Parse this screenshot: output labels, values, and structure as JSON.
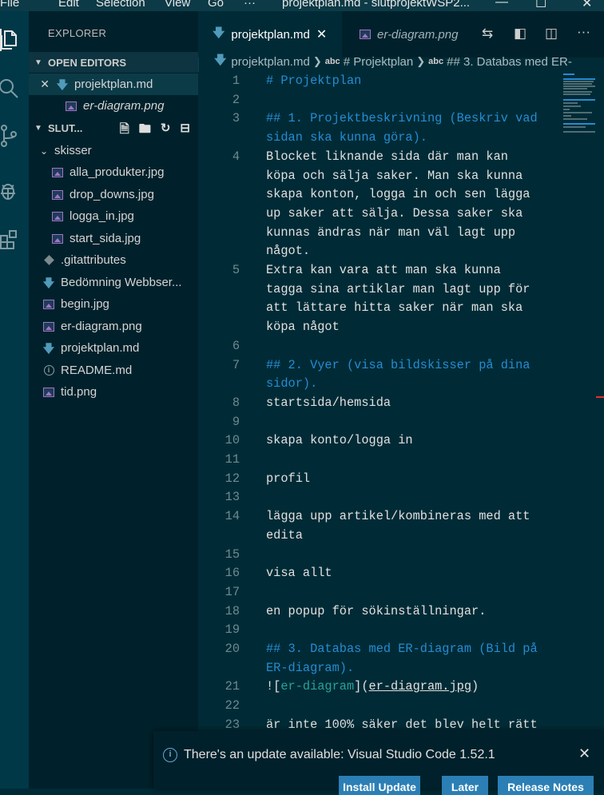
{
  "titlebar": {
    "menu": [
      "File",
      "Edit",
      "Selection",
      "View",
      "Go",
      "···"
    ],
    "title": "projektplan.md - slutprojektWSP2..."
  },
  "sidebar": {
    "title": "EXPLORER",
    "open_editors_label": "OPEN EDITORS",
    "open_editors": [
      {
        "name": "projektplan.md",
        "icon": "markdown-icon"
      },
      {
        "name": "er-diagram.png",
        "icon": "image-icon"
      }
    ],
    "folder_label": "SLUT...",
    "tree": [
      {
        "name": "skisser",
        "type": "folder"
      },
      {
        "name": "alla_produkter.jpg",
        "icon": "image-icon",
        "indent": 2
      },
      {
        "name": "drop_downs.jpg",
        "icon": "image-icon",
        "indent": 2
      },
      {
        "name": "logga_in.jpg",
        "icon": "image-icon",
        "indent": 2
      },
      {
        "name": "start_sida.jpg",
        "icon": "image-icon",
        "indent": 2
      },
      {
        "name": ".gitattributes",
        "icon": "git-icon",
        "indent": 1
      },
      {
        "name": "Bedömning Webbser...",
        "icon": "markdown-icon",
        "indent": 1
      },
      {
        "name": "begin.jpg",
        "icon": "image-icon",
        "indent": 1
      },
      {
        "name": "er-diagram.png",
        "icon": "image-icon",
        "indent": 1
      },
      {
        "name": "projektplan.md",
        "icon": "markdown-icon",
        "indent": 1
      },
      {
        "name": "README.md",
        "icon": "info-icon",
        "indent": 1
      },
      {
        "name": "tid.png",
        "icon": "image-icon",
        "indent": 1
      }
    ]
  },
  "tabs": [
    {
      "label": "projektplan.md",
      "active": true
    },
    {
      "label": "er-diagram.png",
      "active": false
    }
  ],
  "breadcrumb": {
    "file": "projektplan.md",
    "symbol1": "# Projektplan",
    "symbol2": "## 3. Databas med ER-",
    "abc": "abc"
  },
  "editor": {
    "lines": [
      {
        "n": "1",
        "text": "# Projektplan",
        "kind": "h"
      },
      {
        "n": "2",
        "text": ""
      },
      {
        "n": "3",
        "text": "## 1. Projektbeskrivning (Beskriv vad",
        "kind": "h"
      },
      {
        "n": "",
        "text": "sidan ska kunna göra).",
        "kind": "h"
      },
      {
        "n": "4",
        "text": "Blocket liknande sida där man kan"
      },
      {
        "n": "",
        "text": "köpa och sälja saker. Man ska kunna"
      },
      {
        "n": "",
        "text": "skapa konton, logga in och sen lägga"
      },
      {
        "n": "",
        "text": "up saker att sälja. Dessa saker ska"
      },
      {
        "n": "",
        "text": "kunnas ändras när man väl lagt upp"
      },
      {
        "n": "",
        "text": "något."
      },
      {
        "n": "5",
        "text": "Extra kan vara att man ska kunna"
      },
      {
        "n": "",
        "text": "tagga sina artiklar man lagt upp för"
      },
      {
        "n": "",
        "text": "att lättare hitta saker när man ska"
      },
      {
        "n": "",
        "text": "köpa något"
      },
      {
        "n": "6",
        "text": ""
      },
      {
        "n": "7",
        "text": "## 2. Vyer (visa bildskisser på dina",
        "kind": "h"
      },
      {
        "n": "",
        "text": "sidor).",
        "kind": "h"
      },
      {
        "n": "8",
        "text": "startsida/hemsida"
      },
      {
        "n": "9",
        "text": ""
      },
      {
        "n": "10",
        "text": "skapa konto/logga in"
      },
      {
        "n": "11",
        "text": ""
      },
      {
        "n": "12",
        "text": "profil"
      },
      {
        "n": "13",
        "text": ""
      },
      {
        "n": "14",
        "text": "lägga upp artikel/kombineras med att"
      },
      {
        "n": "",
        "text": "edita"
      },
      {
        "n": "15",
        "text": ""
      },
      {
        "n": "16",
        "text": "visa allt"
      },
      {
        "n": "17",
        "text": ""
      },
      {
        "n": "18",
        "text": "en popup för sökinställningar."
      },
      {
        "n": "19",
        "text": ""
      },
      {
        "n": "20",
        "text": "## 3. Databas med ER-diagram (Bild på",
        "kind": "h"
      },
      {
        "n": "",
        "text": "ER-diagram).",
        "kind": "h"
      },
      {
        "n": "21",
        "text": "![er-diagram](er-diagram.jpg)",
        "kind": "link"
      },
      {
        "n": "22",
        "text": ""
      },
      {
        "n": "23",
        "text": "är inte 100% säker det blev helt rätt"
      }
    ]
  },
  "notification": {
    "text": "There's an update available: Visual Studio Code 1.52.1",
    "buttons": [
      "Install Update",
      "Later",
      "Release Notes"
    ]
  },
  "colors": {
    "accent": "#268bd2",
    "link": "#2aa198",
    "background": "#002b36"
  }
}
